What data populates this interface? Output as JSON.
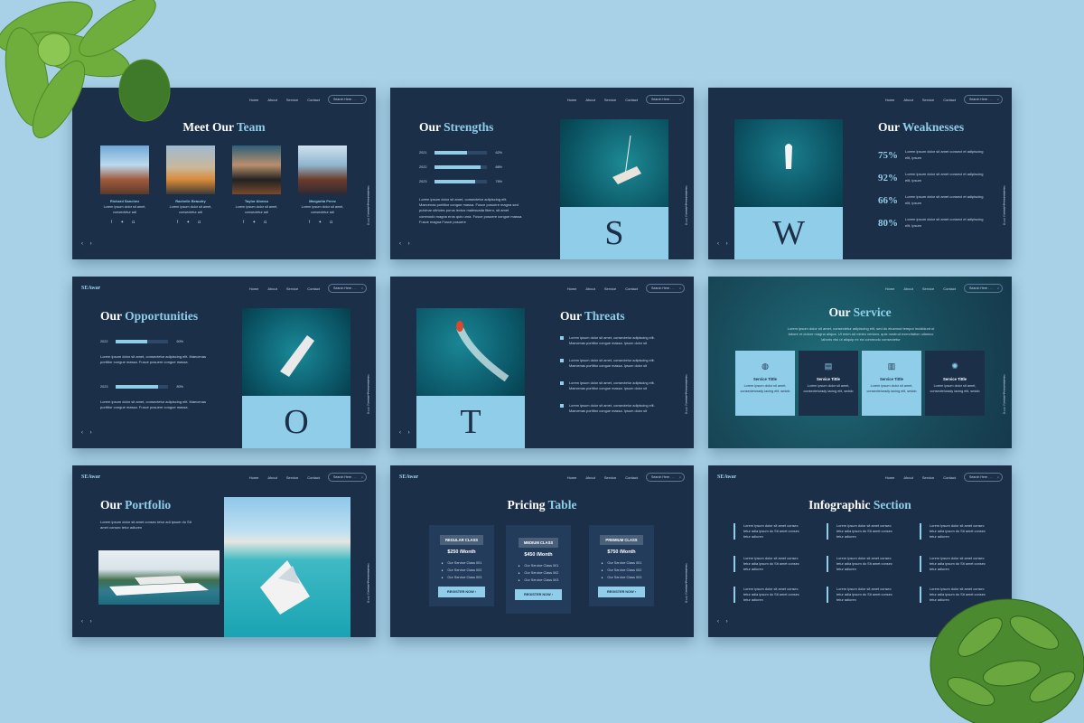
{
  "nav": {
    "logo": "SEAwar",
    "links": [
      "Home",
      "About",
      "Service",
      "Contact"
    ],
    "search_placeholder": "Search Here . . ."
  },
  "pager": "‹ ›",
  "vertical_label": "Boat Rental Presentation",
  "team": {
    "t1": "Meet Our ",
    "t2": "Team",
    "members": [
      {
        "name": "Richard Sanchez",
        "desc": "Lorem ipsum dolor sit amet, consectetur adi"
      },
      {
        "name": "Rachelle Beaudry",
        "desc": "Lorem ipsum dolor sit amet, consectetur adi"
      },
      {
        "name": "Taylor Alonso",
        "desc": "Lorem ipsum dolor sit amet, consectetur adi"
      },
      {
        "name": "Margarita Perez",
        "desc": "Lorem ipsum dolor sit amet, consectetur adi"
      }
    ],
    "social": "f ✦ ◘"
  },
  "strengths": {
    "t1": "Our ",
    "t2": "Strengths",
    "bars": [
      {
        "year": "2021",
        "pct": "62%",
        "value": 62
      },
      {
        "year": "2022",
        "pct": "88%",
        "value": 88
      },
      {
        "year": "2023",
        "pct": "76%",
        "value": 76
      }
    ],
    "text": "Lorem ipsum dolor sit amet, consectetur adipiscing elit. Maecenas porttitor congue massa. Fusce posuere magna sed pulvinar ultricies purus lectus malesuada libero, sit amet commodo magna eros quis urna. Fusce posuere congue massa. Fusce magna Fusce posuere",
    "letter": "S"
  },
  "weak": {
    "t1": "Our ",
    "t2": "Weaknesses",
    "items": [
      {
        "pct": "75%",
        "text": "Lorem ipsum dolor sit amet consect et adipiscing elit, ipsum"
      },
      {
        "pct": "92%",
        "text": "Lorem ipsum dolor sit amet consect et adipiscing elit, ipsum"
      },
      {
        "pct": "66%",
        "text": "Lorem ipsum dolor sit amet consect et adipiscing elit, ipsum"
      },
      {
        "pct": "80%",
        "text": "Lorem ipsum dolor sit amet consect et adipiscing elit, ipsum"
      }
    ],
    "letter": "W"
  },
  "opp": {
    "t1": "Our ",
    "t2": "Opportunities",
    "bars": [
      {
        "year": "2022",
        "pct": "60%",
        "value": 60
      },
      {
        "year": "2023",
        "pct": "80%",
        "value": 80
      }
    ],
    "text1": "Lorem ipsum dolor sit amet, consectetur adipiscing elit. Maecenas porttitor congue massa. Fusce posuere congue massa.",
    "text2": "Lorem ipsum dolor sit amet, consectetur adipiscing elit. Maecenas porttitor congue massa. Fusce posuere congue massa.",
    "letter": "O"
  },
  "threats": {
    "t1": "Our ",
    "t2": "Threats",
    "items": [
      "Lorem ipsum dolor sit amet, consectetur adipiscing elit. Maecenas porttitor congue massa. Ipsum dolor sit",
      "Lorem ipsum dolor sit amet, consectetur adipiscing elit. Maecenas porttitor congue massa. Ipsum dolor sit",
      "Lorem ipsum dolor sit amet, consectetur adipiscing elit. Maecenas porttitor congue massa. Ipsum dolor sit",
      "Lorem ipsum dolor sit amet, consectetur adipiscing elit. Maecenas porttitor congue massa. Ipsum dolor sit"
    ],
    "letter": "T"
  },
  "service": {
    "t1": "Our ",
    "t2": "Service",
    "text": "Lorem ipsum dolor sit amet, consectetur adipiscing elit, sed do eiusmod tempor incididunt ut labore et dolore magna aliqua. Ut enim ad minim veniam, quis nostrud exercitation ullamco laboris nisi ut aliquip ex ea commodo consectetur",
    "cards": [
      {
        "title": "Service Tittle",
        "desc": "Lorem ipsum dolor sit amet, consecteturady lacing elit, seddo"
      },
      {
        "title": "Service Tittle",
        "desc": "Lorem ipsum dolor sit amet, consecteturady lacing elit, seddo"
      },
      {
        "title": "Service Tittle",
        "desc": "Lorem ipsum dolor sit amet, consecteturady lacing elit, seddo"
      },
      {
        "title": "Service Tittle",
        "desc": "Lorem ipsum dolor sit amet, consecteturady lacing elit, seddo"
      }
    ]
  },
  "portfolio": {
    "t1": "Our ",
    "t2": "Portfolio",
    "text": "Lorem ipsum dolor sit amet consec tetur adi ipsum do Sit amet consec tetur adiuren"
  },
  "pricing": {
    "t1": "Pricing ",
    "t2": "Table",
    "plans": [
      {
        "name": "REGULAR CLASS",
        "price": "$250 /Month",
        "items": [
          "Our Service Class 001",
          "Our Service Class 002",
          "Our Service Class 003"
        ],
        "button": "REGISTER NOW  ›"
      },
      {
        "name": "MEDIUM CLASS",
        "price": "$450 /Month",
        "items": [
          "Our Service Class 001",
          "Our Service Class 002",
          "Our Service Class 003"
        ],
        "button": "REGISTER NOW  ›"
      },
      {
        "name": "PREMIUM CLASS",
        "price": "$750 /Month",
        "items": [
          "Our Service Class 001",
          "Our Service Class 002",
          "Our Service Class 003"
        ],
        "button": "REGISTER NOW  ›"
      }
    ]
  },
  "info": {
    "t1": "Infographic ",
    "t2": "Section",
    "item": "Lorem Ipsum dolor sit amet consec tetur adia ipsum do Sit amet consec tetur adiuren"
  }
}
